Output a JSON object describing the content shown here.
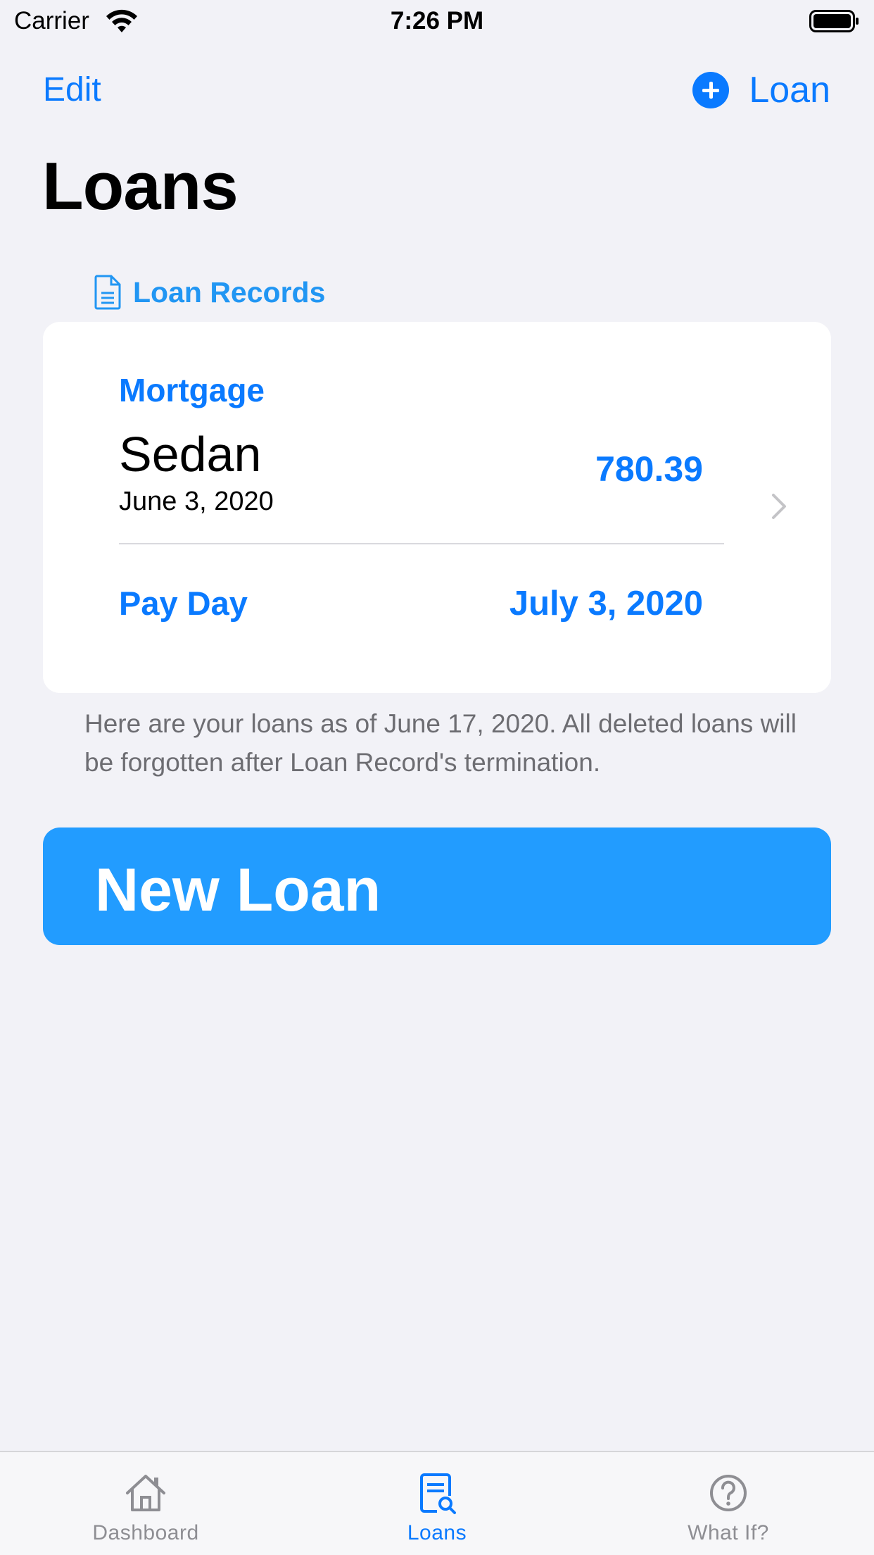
{
  "status_bar": {
    "carrier": "Carrier",
    "time": "7:26 PM"
  },
  "nav": {
    "edit_label": "Edit",
    "add_label": "Loan",
    "title": "Loans"
  },
  "section": {
    "header": "Loan Records"
  },
  "loan": {
    "type": "Mortgage",
    "name": "Sedan",
    "date": "June 3, 2020",
    "amount": "780.39",
    "payday_label": "Pay Day",
    "payday_value": "July 3, 2020"
  },
  "footnote": "Here are your loans as of June 17, 2020. All deleted loans will be forgotten after Loan Record's termination.",
  "new_loan_button": "New Loan",
  "tabs": [
    {
      "label": "Dashboard",
      "icon": "house-icon",
      "active": false
    },
    {
      "label": "Loans",
      "icon": "doc-search-icon",
      "active": true
    },
    {
      "label": "What If?",
      "icon": "question-circle-icon",
      "active": false
    }
  ],
  "colors": {
    "accent": "#0a7aff",
    "button": "#229cff",
    "background": "#f2f2f7"
  }
}
